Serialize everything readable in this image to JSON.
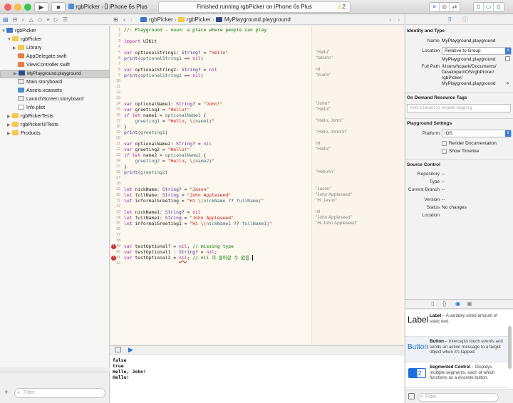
{
  "toolbar": {
    "scheme_target": "rgbPicker",
    "scheme_separator": "›",
    "scheme_device": "iPhone 6s Plus",
    "status_text": "Finished running rgbPicker on iPhone 6s Plus",
    "warning_count": "2"
  },
  "navigator": {
    "items": [
      {
        "label": "rgbPicker"
      },
      {
        "label": "rgbPicker"
      },
      {
        "label": "Library"
      },
      {
        "label": "AppDelegate.swift"
      },
      {
        "label": "ViewController.swift"
      },
      {
        "label": "MyPlayground.playground"
      },
      {
        "label": "Main.storyboard"
      },
      {
        "label": "Assets.xcassets"
      },
      {
        "label": "LaunchScreen.storyboard"
      },
      {
        "label": "Info.plist"
      },
      {
        "label": "rgbPickerTests"
      },
      {
        "label": "rgbPickerUITests"
      },
      {
        "label": "Products"
      }
    ],
    "filter_placeholder": "Filter"
  },
  "jumpbar": {
    "crumbs": [
      "rgbPicker",
      "rgbPicker",
      "MyPlayground.playground"
    ]
  },
  "editor": {
    "line_numbers": [
      "1",
      "2",
      "3",
      "4",
      "5",
      "6",
      "7",
      "8",
      "9",
      "10",
      "11",
      "12",
      "13",
      "14",
      "15",
      "16",
      "17",
      "18",
      "19",
      "20",
      "21",
      "22",
      "23",
      "24",
      "25",
      "26",
      "27",
      "28",
      "29",
      "30",
      "31",
      "32",
      "33",
      "34",
      "35",
      "36",
      "37",
      "38",
      "39",
      "40",
      "41",
      "42"
    ],
    "results": [
      "\"Hello\"",
      "\"false\\n\"",
      "nil",
      "\"true\\n\"",
      "\"John!\"",
      "\"Hello!\"",
      "\"Hello, John!\"",
      "\"Hello, John!\\n\"",
      "nil",
      "\"Hello!\"",
      "\"Hello!\\n\"",
      "\"Jason\"",
      "\"John Appleseed\"",
      "\"Hi Jason\"",
      "nil",
      "\"John Appleseed\"",
      "\"Hi John Appleseed\""
    ],
    "error_markers": [
      "!",
      "!"
    ]
  },
  "console": {
    "lines": [
      "false",
      "true",
      "Hello, John!",
      "Hello!"
    ]
  },
  "inspector": {
    "identity_title": "Identity and Type",
    "name_label": "Name",
    "name_value": "MyPlayground.playground",
    "location_label": "Location",
    "location_value": "Relative to Group",
    "location_file": "MyPlayground.playground",
    "full_path_label": "Full Path",
    "full_path_value": [
      "/Users/hcpark/Documents/",
      "Developer/iOS/rgbPicker/",
      "rgbPicker/",
      "MyPlayground.playground"
    ],
    "odr_title": "On Demand Resource Tags",
    "odr_placeholder": "Add a target to enable tagging",
    "playground_title": "Playground Settings",
    "platform_label": "Platform",
    "platform_value": "iOS",
    "render_doc_label": "Render Documentation",
    "show_timeline_label": "Show Timeline",
    "source_title": "Source Control",
    "repository_label": "Repository",
    "repository_value": "--",
    "type_label": "Type",
    "type_value": "--",
    "branch_label": "Current Branch",
    "branch_value": "--",
    "version_label": "Version",
    "version_value": "--",
    "status_label": "Status",
    "status_value": "No changes",
    "location2_label": "Location"
  },
  "library": {
    "items": [
      {
        "icon_text": "Label",
        "title": "Label",
        "desc": " – A variably sized amount of static text."
      },
      {
        "icon_text": "Button",
        "title": "Button",
        "desc": " – Intercepts touch events and sends an action message to a target object when it's tapped."
      },
      {
        "icon_text": "1 2",
        "title": "Segmented Control",
        "desc": " – Displays multiple segments, each of which functions as a discrete button."
      }
    ]
  },
  "colors": {
    "accent": "#1a6fe0",
    "error": "#d12f2f",
    "editor_bg": "#fcf7ef",
    "keyword": "#b01f8e",
    "string": "#c41a16",
    "comment": "#007400"
  }
}
